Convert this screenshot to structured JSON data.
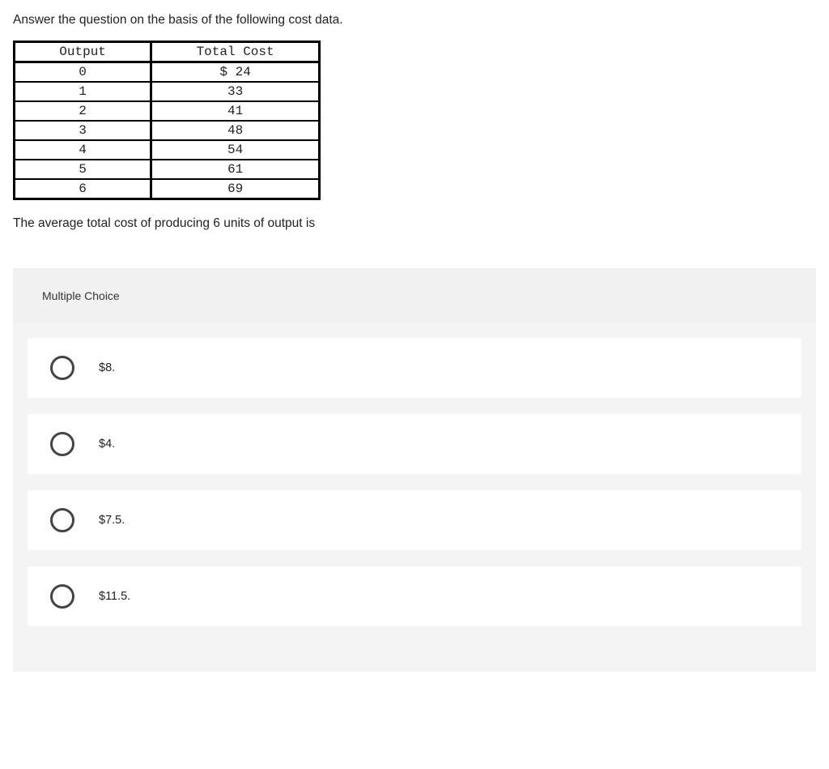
{
  "prompt": "Answer the question on the basis of the following cost data.",
  "table": {
    "headers": {
      "output": "Output",
      "total_cost": "Total Cost"
    },
    "rows": [
      {
        "output": "0",
        "total_cost": "$ 24"
      },
      {
        "output": "1",
        "total_cost": "33"
      },
      {
        "output": "2",
        "total_cost": "41"
      },
      {
        "output": "3",
        "total_cost": "48"
      },
      {
        "output": "4",
        "total_cost": "54"
      },
      {
        "output": "5",
        "total_cost": "61"
      },
      {
        "output": "6",
        "total_cost": "69"
      }
    ]
  },
  "question": "The average total cost of producing 6 units of output is",
  "mc_label": "Multiple Choice",
  "options": [
    {
      "label": "$8."
    },
    {
      "label": "$4."
    },
    {
      "label": "$7.5."
    },
    {
      "label": "$11.5."
    }
  ]
}
